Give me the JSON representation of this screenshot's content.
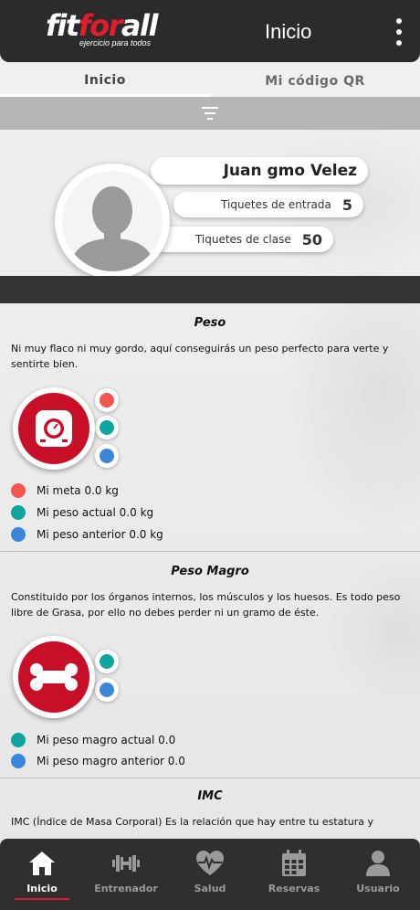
{
  "header": {
    "logo_parts": [
      "fit",
      "for",
      "all"
    ],
    "logo_tagline": "ejercicio para todos",
    "title": "Inicio"
  },
  "tabs": [
    {
      "label": "Inicio",
      "active": true
    },
    {
      "label": "Mi código QR",
      "active": false
    }
  ],
  "profile": {
    "name": "Juan gmo Velez",
    "entry_label": "Tiquetes de entrada",
    "entry_count": "5",
    "class_label": "Tiquetes de clase",
    "class_count": "50"
  },
  "sections": {
    "peso": {
      "title": "Peso",
      "description": "Ni muy flaco ni muy gordo, aquí conseguirás un peso perfecto para verte y sentirte bien.",
      "icon": "scale-icon",
      "legend": [
        {
          "label": "Mi meta 0.0 kg",
          "color": "#f2564e"
        },
        {
          "label": "Mi peso actual 0.0 kg",
          "color": "#10a6a0"
        },
        {
          "label": "Mi peso anterior 0.0 kg",
          "color": "#3b86d9"
        }
      ]
    },
    "peso_magro": {
      "title": "Peso Magro",
      "description": "Constituido por los órganos internos, los músculos y los huesos. Es todo peso libre de Grasa, por ello no debes perder ni un gramo de éste.",
      "icon": "bone-icon",
      "legend": [
        {
          "label": "Mi peso magro actual 0.0",
          "color": "#10a6a0"
        },
        {
          "label": "Mi peso magro anterior 0.0",
          "color": "#3b86d9"
        }
      ]
    },
    "imc": {
      "title": "IMC",
      "description": "IMC (Índice de Masa Corporal) Es la relación que hay entre tu estatura y"
    }
  },
  "bottom_nav": [
    {
      "label": "Inicio",
      "icon": "home-icon",
      "active": true
    },
    {
      "label": "Entrenador",
      "icon": "dumbbell-icon",
      "active": false
    },
    {
      "label": "Salud",
      "icon": "heart-pulse-icon",
      "active": false
    },
    {
      "label": "Reservas",
      "icon": "calendar-icon",
      "active": false
    },
    {
      "label": "Usuario",
      "icon": "user-icon",
      "active": false
    }
  ],
  "colors": {
    "brand_red": "#e01c2f",
    "icon_red": "#c70f28",
    "header_bg": "#2b2b2b"
  }
}
